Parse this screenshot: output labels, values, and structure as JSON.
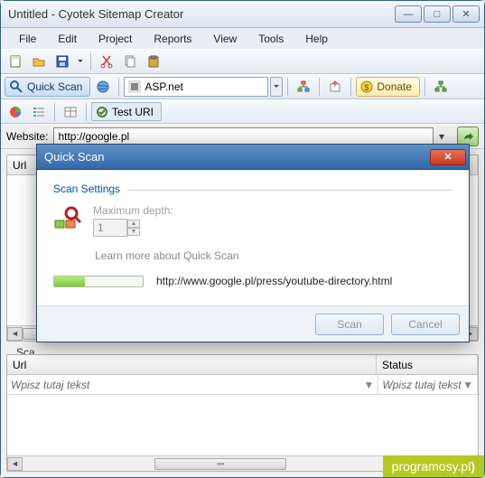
{
  "window": {
    "title": "Untitled - Cyotek Sitemap Creator"
  },
  "menu": {
    "file": "File",
    "edit": "Edit",
    "project": "Project",
    "reports": "Reports",
    "view": "View",
    "tools": "Tools",
    "help": "Help"
  },
  "toolbar1": {
    "quick_scan": "Quick Scan",
    "address_value": "ASP.net",
    "donate": "Donate"
  },
  "toolbar2": {
    "test_uri": "Test URI"
  },
  "website": {
    "label": "Website:",
    "value": "http://google.pl"
  },
  "upper_panel": {
    "col_url": "Url",
    "filter_placeholder": "Wpisz tutaj tekst"
  },
  "lower_panel": {
    "group_label": "Sca",
    "col_url": "Url",
    "col_status": "Status",
    "filter_placeholder": "Wpisz tutaj tekst"
  },
  "dialog": {
    "title": "Quick Scan",
    "section": "Scan Settings",
    "depth_label": "Maximum depth:",
    "depth_value": "1",
    "learn": "Learn more about Quick Scan",
    "progress_url": "http://www.google.pl/press/youtube-directory.html",
    "scan_btn": "Scan",
    "cancel_btn": "Cancel"
  },
  "watermark": "programosy.pl"
}
